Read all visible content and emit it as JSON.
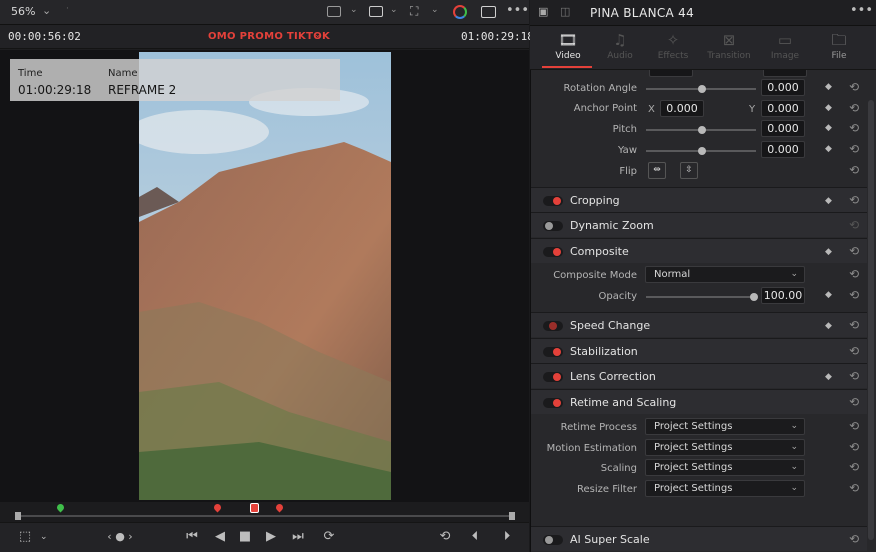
{
  "viewer": {
    "zoom": "56%",
    "zoom_chevron": "⌄",
    "timecode_left": "00:00:56:02",
    "title": "OMO PROMO TIKTOK",
    "timecode_right": "01:00:29:18",
    "overlay": {
      "time_label": "Time",
      "time_value": "01:00:29:18",
      "name_label": "Name",
      "name_value": "REFRAME 2"
    }
  },
  "inspector": {
    "title": "PINA BLANCA 44",
    "tabs": [
      {
        "label": "Video",
        "icon": "film-icon",
        "active": true
      },
      {
        "label": "Audio",
        "icon": "music-icon",
        "active": false
      },
      {
        "label": "Effects",
        "icon": "wand-icon",
        "active": false
      },
      {
        "label": "Transition",
        "icon": "transition-icon",
        "active": false
      },
      {
        "label": "Image",
        "icon": "image-icon",
        "active": false
      },
      {
        "label": "File",
        "icon": "file-icon",
        "active": false
      }
    ],
    "transform": {
      "rotation_label": "Rotation Angle",
      "rotation_value": "0.000",
      "anchor_label": "Anchor Point",
      "anchor_x_label": "X",
      "anchor_x": "0.000",
      "anchor_y_label": "Y",
      "anchor_y": "0.000",
      "pitch_label": "Pitch",
      "pitch_value": "0.000",
      "yaw_label": "Yaw",
      "yaw_value": "0.000",
      "flip_label": "Flip"
    },
    "sections": {
      "cropping": "Cropping",
      "dynamic_zoom": "Dynamic Zoom",
      "composite": "Composite",
      "speed_change": "Speed Change",
      "stabilization": "Stabilization",
      "lens_correction": "Lens Correction",
      "retime_scaling": "Retime and Scaling",
      "ai_super_scale": "AI Super Scale"
    },
    "composite": {
      "mode_label": "Composite Mode",
      "mode_value": "Normal",
      "opacity_label": "Opacity",
      "opacity_value": "100.00"
    },
    "retime": {
      "process_label": "Retime Process",
      "process_value": "Project Settings",
      "motion_label": "Motion Estimation",
      "motion_value": "Project Settings",
      "scaling_label": "Scaling",
      "scaling_value": "Project Settings",
      "resize_label": "Resize Filter",
      "resize_value": "Project Settings"
    }
  },
  "colors": {
    "accent": "#e4413a",
    "green": "#3fbf4a"
  }
}
